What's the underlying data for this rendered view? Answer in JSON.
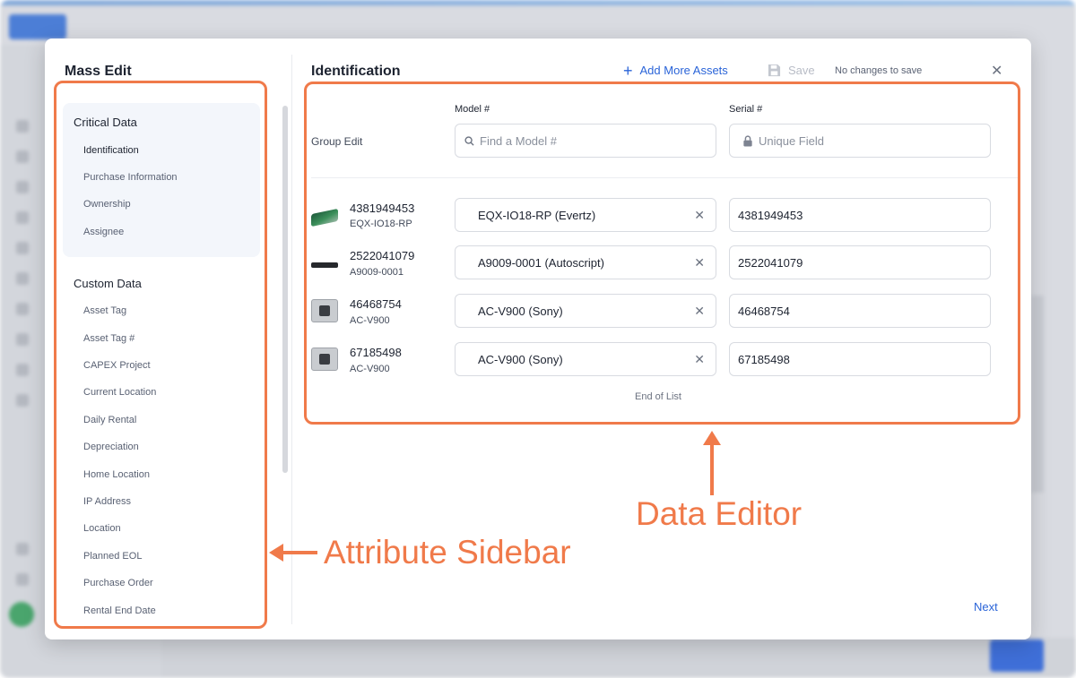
{
  "modal": {
    "title": "Mass Edit",
    "section_title": "Identification",
    "add_more": "Add More Assets",
    "save": "Save",
    "status": "No changes to save",
    "next": "Next"
  },
  "sidebar": {
    "critical_heading": "Critical Data",
    "critical_items": [
      "Identification",
      "Purchase Information",
      "Ownership",
      "Assignee"
    ],
    "custom_heading": "Custom Data",
    "custom_items": [
      "Asset Tag",
      "Asset Tag #",
      "CAPEX Project",
      "Current Location",
      "Daily Rental",
      "Depreciation",
      "Home Location",
      "IP Address",
      "Location",
      "Planned EOL",
      "Purchase Order",
      "Rental End Date"
    ]
  },
  "editor": {
    "model_header": "Model #",
    "serial_header": "Serial #",
    "group_edit": "Group Edit",
    "model_placeholder": "Find a Model #",
    "serial_placeholder": "Unique Field",
    "end_of_list": "End of List",
    "rows": [
      {
        "id": "4381949453",
        "model": "EQX-IO18-RP",
        "model_value": "EQX-IO18-RP (Evertz)",
        "serial": "4381949453",
        "thumb": "green-rack-unit"
      },
      {
        "id": "2522041079",
        "model": "A9009-0001",
        "model_value": "A9009-0001 (Autoscript)",
        "serial": "2522041079",
        "thumb": "black-rack-unit"
      },
      {
        "id": "46468754",
        "model": "AC-V900",
        "model_value": "AC-V900 (Sony)",
        "serial": "46468754",
        "thumb": "camera-adapter"
      },
      {
        "id": "67185498",
        "model": "AC-V900",
        "model_value": "AC-V900 (Sony)",
        "serial": "67185498",
        "thumb": "camera-adapter"
      }
    ]
  },
  "annotations": {
    "sidebar_label": "Attribute Sidebar",
    "editor_label": "Data Editor",
    "color": "#f07a4a"
  },
  "icons": {
    "plus": "plus-icon",
    "save": "floppy-disk-icon",
    "close": "close-icon",
    "search": "search-icon",
    "lock": "lock-icon",
    "clear": "clear-icon"
  },
  "colors": {
    "accent": "#2a64d8",
    "annotation": "#f07a4a",
    "panel_bg": "#f3f6fb"
  }
}
